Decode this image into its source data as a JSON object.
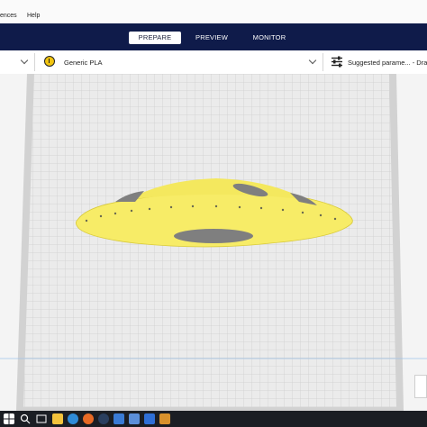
{
  "menu": {
    "items": [
      "ences",
      "Help"
    ]
  },
  "header": {
    "tabs": [
      {
        "label": "PREPARE",
        "active": true
      },
      {
        "label": "PREVIEW",
        "active": false
      },
      {
        "label": "MONITOR",
        "active": false
      }
    ],
    "background_color": "#0f1b4a"
  },
  "toolbar": {
    "material_label": "Generic PLA",
    "material_color": "#f1c40f",
    "print_settings_label": "Suggested parame... - Dra",
    "material_icon": "material-badge-icon",
    "settings_icon": "sliders-icon"
  },
  "viewport": {
    "model_color": "#f7ec67",
    "build_plate_color": "#e9e9e9",
    "grid_color": "#c9c9c9",
    "shadow_color": "#7f7f7f"
  },
  "taskbar": {
    "icons": [
      "windows-start-icon",
      "search-icon",
      "task-view-icon",
      "explorer-icon",
      "edge-icon",
      "firefox-icon",
      "steam-icon",
      "store-icon",
      "cura-icon",
      "mail-icon",
      "app-icon"
    ]
  }
}
